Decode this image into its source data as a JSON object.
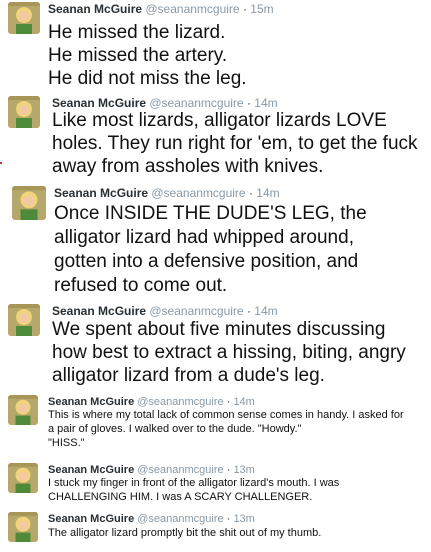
{
  "tweets": [
    {
      "name": "Seanan McGuire",
      "handle": "@seananmcguire",
      "time": "15m",
      "text": "He missed the lizard.\nHe missed the artery.\nHe did not miss the leg."
    },
    {
      "name": "Seanan McGuire",
      "handle": "@seananmcguire",
      "time": "14m",
      "text": "Like most lizards, alligator lizards LOVE holes. They run right for 'em, to get the fuck away from assholes with knives."
    },
    {
      "name": "Seanan McGuire",
      "handle": "@seananmcguire",
      "time": "14m",
      "text": "Once INSIDE THE DUDE'S LEG, the alligator lizard had whipped around, gotten into a defensive position, and refused to come out."
    },
    {
      "name": "Seanan McGuire",
      "handle": "@seananmcguire",
      "time": "14m",
      "text": "We spent about five minutes discussing how best to extract a hissing, biting, angry alligator lizard from a dude's leg."
    },
    {
      "name": "Seanan McGuire",
      "handle": "@seananmcguire",
      "time": "14m",
      "text": "This is where my total lack of common sense comes in handy. I asked for a pair of gloves. I walked over to the dude. \"Howdy.\"\n\"HISS.\""
    },
    {
      "name": "Seanan McGuire",
      "handle": "@seananmcguire",
      "time": "13m",
      "text": "I stuck my finger in front of the alligator lizard's mouth. I was CHALLENGING HIM. I was A SCARY CHALLENGER."
    },
    {
      "name": "Seanan McGuire",
      "handle": "@seananmcguire",
      "time": "13m",
      "text": "The alligator lizard promptly bit the shit out of my thumb."
    }
  ]
}
